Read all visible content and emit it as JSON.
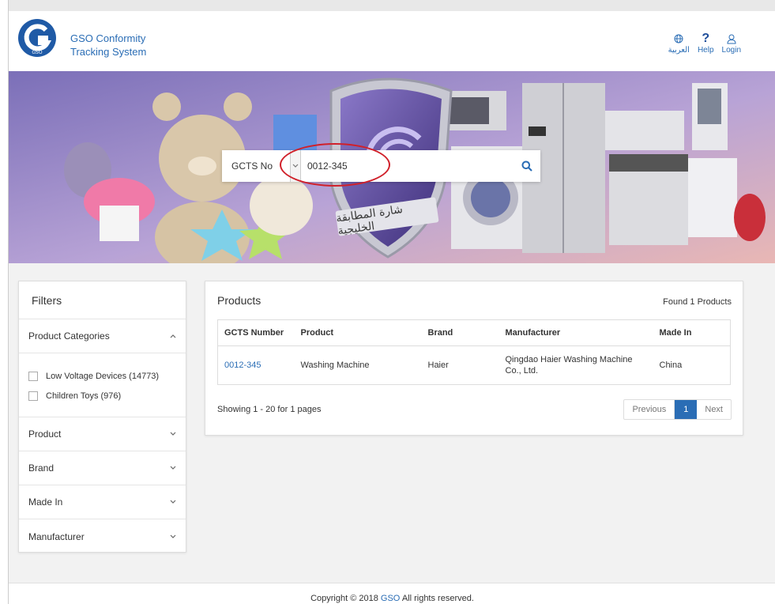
{
  "header": {
    "brand_line1": "GSO Conformity",
    "brand_line2": "Tracking System",
    "logo_text": "GSO",
    "nav": {
      "arabic_label": "العربية",
      "help_label": "Help",
      "login_label": "Login"
    }
  },
  "hero": {
    "badge_text": "شارة المطابقة الخليجية",
    "search": {
      "type_label": "GCTS No",
      "value": "0012-345"
    }
  },
  "filters": {
    "title": "Filters",
    "sections": {
      "categories": "Product Categories",
      "product": "Product",
      "brand": "Brand",
      "made_in": "Made In",
      "manufacturer": "Manufacturer"
    },
    "categories": [
      "Low Voltage Devices (14773)",
      "Children Toys (976)"
    ]
  },
  "products": {
    "title": "Products",
    "found": "Found 1 Products",
    "columns": {
      "gcts": "GCTS Number",
      "product": "Product",
      "brand": "Brand",
      "manufacturer": "Manufacturer",
      "made_in": "Made In"
    },
    "rows": [
      {
        "gcts": "0012-345",
        "product": "Washing Machine",
        "brand": "Haier",
        "manufacturer": "Qingdao Haier Washing Machine Co., Ltd.",
        "made_in": "China"
      }
    ],
    "showing": "Showing 1 - 20 for 1 pages",
    "pagination": {
      "previous": "Previous",
      "current": "1",
      "next": "Next"
    }
  },
  "footer": {
    "prefix": "Copyright © 2018",
    "link": "GSO",
    "suffix": "All rights reserved."
  },
  "colors": {
    "accent": "#2a6db5",
    "logo": "#1f5aa6",
    "highlight_ring": "#d0202a",
    "page_bg": "#f2f2f2"
  }
}
